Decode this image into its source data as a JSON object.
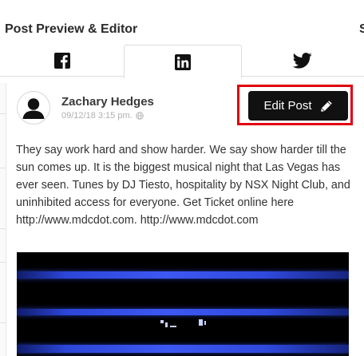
{
  "header": {
    "title": "Post Preview & Editor",
    "next_title_fragment": "S"
  },
  "tabs": [
    {
      "name": "Facebook",
      "icon": "facebook-icon",
      "active": false
    },
    {
      "name": "LinkedIn",
      "icon": "linkedin-icon",
      "active": true
    },
    {
      "name": "Twitter",
      "icon": "twitter-icon",
      "active": false
    }
  ],
  "post": {
    "author": "Zachary Hedges",
    "timestamp": "09/12/18 3:15 pm.",
    "visibility_icon": "globe-icon",
    "avatar_icon": "user-avatar-icon",
    "body": "They say work hard and show harder. We say show harder till the sun comes up. It is the biggest musical night that Las Vegas has ever seen. Tunes by DJ Tiesto, hospitality by NSX Night Club, and uninhibited access for everyone. Get Ticket online here http://www.mdcdot.com. http://www.mdcdot.com",
    "image_description_icon": "concert-stage-image"
  },
  "edit_button": {
    "label": "Edit Post",
    "icon": "pencil-icon"
  },
  "colors": {
    "highlight": "#e0000f",
    "button_bg": "#111111",
    "button_text": "#ffffff",
    "stage_light": "#3d58f2"
  }
}
